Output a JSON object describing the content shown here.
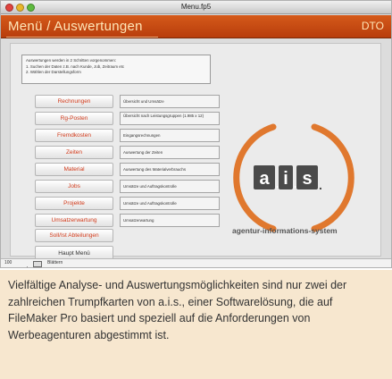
{
  "window": {
    "title": "Menu.fp5"
  },
  "header": {
    "title": "Menü / Auswertungen",
    "tag": "DTO"
  },
  "info": {
    "lines": [
      "Auswertungen werden in 2 Schritten vorgenommen:",
      "1. Suchen der Daten z.B. nach Kunde, Job, Zeitraum etc",
      "2. Wählen der Darstellungsform"
    ]
  },
  "menu": [
    {
      "label": "Rechnungen",
      "desc": "Übersicht und Umsätze"
    },
    {
      "label": "Rg-Posten",
      "desc": "Übersicht nach Leistungsgruppen (1.985 x 12)"
    },
    {
      "label": "Fremdkosten",
      "desc": "Eingangsrechnungen"
    },
    {
      "label": "Zeiten",
      "desc": "Auswertung der Zeiten"
    },
    {
      "label": "Material",
      "desc": "Auswertung des Materialverbrauchs"
    },
    {
      "label": "Jobs",
      "desc": "Umsätze und Auftragskontrolle"
    },
    {
      "label": "Projekte",
      "desc": "Umsätze und Auftragskontrolle"
    },
    {
      "label": "Umsatzerwartung",
      "desc": "Umsatzerwartung"
    },
    {
      "label": "Soll/Ist Abteilungen",
      "desc": ""
    }
  ],
  "main_menu_label": "Haupt Menü",
  "logo": {
    "wordmark": "a.i.s.",
    "tagline": "agentur-informations-system"
  },
  "status": {
    "zoom": "100",
    "mode": "Blättern"
  },
  "caption": "Vielfältige Analyse- und Auswertungsmöglichkeiten sind nur zwei der zahlreichen Trumpfkarten von a.i.s., einer Softwarelösung, die auf FileMaker Pro basiert und speziell auf die Anforderungen von Werbeagenturen abgestimmt ist.",
  "colors": {
    "header": "#c84b14",
    "button_text": "#d23a1a",
    "caption_bg": "#f7e7cf",
    "logo_arc": "#e0782e"
  }
}
